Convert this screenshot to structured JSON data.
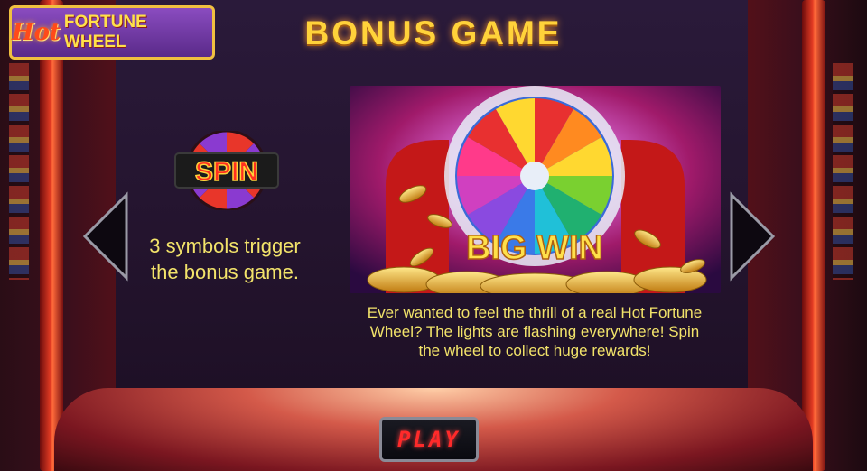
{
  "logo": {
    "hot": "Hot",
    "text": "FORTUNE WHEEL"
  },
  "title": "BONUS GAME",
  "left": {
    "symbol_label": "SPIN",
    "description": "3 symbols trigger the bonus game."
  },
  "promo": {
    "banner": "BIG WIN"
  },
  "right": {
    "description": "Ever wanted to feel the thrill of a real Hot Fortune Wheel? The lights are flashing everywhere! Spin the wheel to collect huge rewards!"
  },
  "nav": {
    "prev_icon": "chevron-left-icon",
    "next_icon": "chevron-right-icon"
  },
  "play_button": {
    "label": "PLAY"
  },
  "colors": {
    "accent_gold": "#ffd23a",
    "text_yellow": "#f2e36a",
    "play_red": "#ff2a2a",
    "panel": "#24142e"
  }
}
